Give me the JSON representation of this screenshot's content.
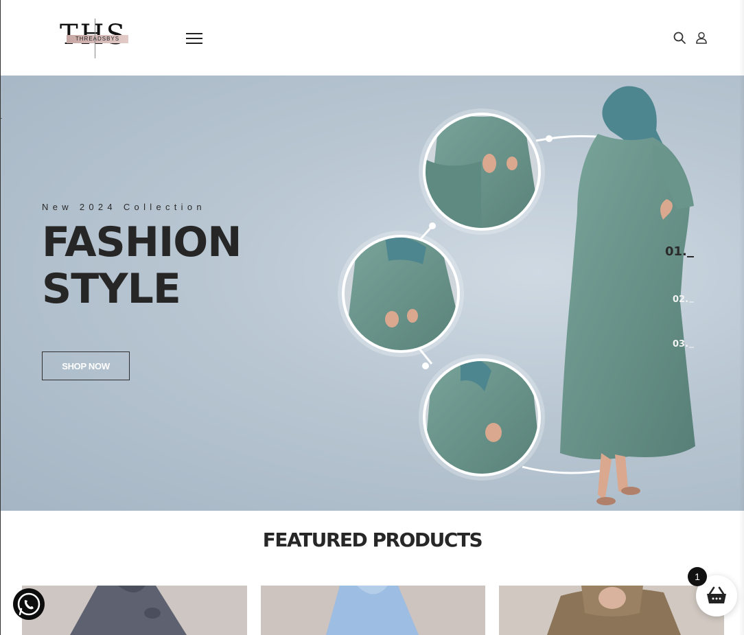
{
  "header": {
    "logo_main": "THS",
    "logo_sub": "THREADSBYS",
    "menu_icon": "hamburger-menu-icon",
    "search_icon": "search-icon",
    "account_icon": "user-icon"
  },
  "hero": {
    "tagline": "New 2024 Collection",
    "headline_line1": "FASHION",
    "headline_line2": "STYLE",
    "cta_label": "SHOP NOW",
    "slides": [
      {
        "label": "01.",
        "active": true
      },
      {
        "label": "02.",
        "active": false
      },
      {
        "label": "03.",
        "active": false
      }
    ],
    "garment_color": "#6b958c",
    "hijab_color": "#4e8690"
  },
  "featured": {
    "title": "FEATURED PRODUCTS",
    "products": [
      {
        "name": "product-1",
        "color": "#5d6170",
        "bg": "#cec6c2"
      },
      {
        "name": "product-2",
        "color": "#9dbde2",
        "bg": "#cdc3bf"
      },
      {
        "name": "product-3",
        "color": "#8c7458",
        "bg": "#d0c8c1"
      }
    ]
  },
  "floating": {
    "whatsapp_icon": "whatsapp-icon",
    "cart_icon": "basket-icon",
    "cart_count": "1"
  }
}
